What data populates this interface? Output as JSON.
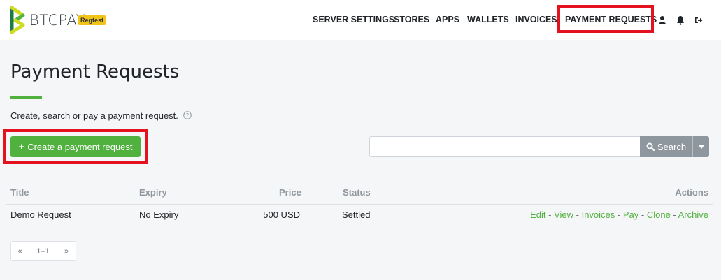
{
  "brand": {
    "name": "BTCPAY",
    "badge": "Regtest"
  },
  "nav": {
    "items": [
      "SERVER SETTINGS",
      "STORES",
      "APPS",
      "WALLETS",
      "INVOICES",
      "PAYMENT REQUESTS"
    ],
    "icons": [
      "user-icon",
      "bell-icon",
      "sign-out-icon"
    ]
  },
  "page": {
    "title": "Payment Requests",
    "description": "Create, search or pay a payment request.",
    "create_button": "Create a payment request"
  },
  "search": {
    "placeholder": "",
    "value": "",
    "button_label": "Search"
  },
  "table": {
    "headers": {
      "title": "Title",
      "expiry": "Expiry",
      "price": "Price",
      "status": "Status",
      "actions": "Actions"
    },
    "rows": [
      {
        "title": "Demo Request",
        "expiry": "No Expiry",
        "price": "500 USD",
        "status": "Settled",
        "actions": [
          "Edit",
          "View",
          "Invoices",
          "Pay",
          "Clone",
          "Archive"
        ]
      }
    ]
  },
  "pagination": {
    "prev": "«",
    "range": "1–1",
    "next": "»"
  },
  "colors": {
    "accent": "#51b13e",
    "highlight": "#e3121e",
    "badge": "#f0c419",
    "search_button": "#8f979e"
  }
}
